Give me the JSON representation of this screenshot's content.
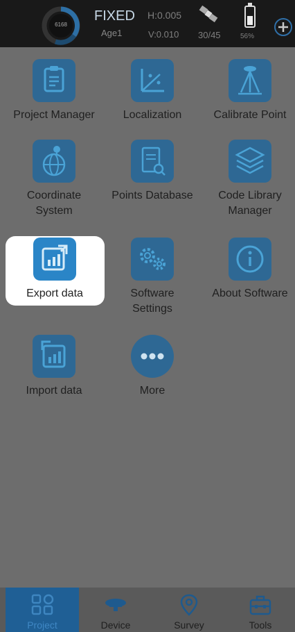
{
  "status": {
    "gauge_value": "6168",
    "fix_status": "FIXED",
    "age_label": "Age1",
    "h_precision": "H:0.005",
    "v_precision": "V:0.010",
    "satellites": "30/45",
    "battery_percent": "56%",
    "battery_level": 0.56
  },
  "menu": {
    "items": [
      {
        "label": "Project Manager",
        "icon": "clipboard-icon"
      },
      {
        "label": "Localization",
        "icon": "axes-icon"
      },
      {
        "label": "Calibrate Point",
        "icon": "tripod-icon"
      },
      {
        "label": "Coordinate System",
        "icon": "globe-pin-icon"
      },
      {
        "label": "Points Database",
        "icon": "document-search-icon"
      },
      {
        "label": "Code Library Manager",
        "icon": "layers-icon"
      },
      {
        "label": "Export data",
        "icon": "export-chart-icon"
      },
      {
        "label": "Software Settings",
        "icon": "gears-icon"
      },
      {
        "label": "About Software",
        "icon": "info-icon"
      },
      {
        "label": "Import data",
        "icon": "import-chart-icon"
      },
      {
        "label": "More",
        "icon": "more-dots-icon"
      }
    ]
  },
  "tabs": [
    {
      "label": "Project",
      "icon": "grid-icon",
      "active": true
    },
    {
      "label": "Device",
      "icon": "receiver-icon",
      "active": false
    },
    {
      "label": "Survey",
      "icon": "location-pin-icon",
      "active": false
    },
    {
      "label": "Tools",
      "icon": "toolbox-icon",
      "active": false
    }
  ],
  "colors": {
    "accent": "#1f6fb8",
    "fixed_text": "#c7d8e6",
    "overlay": "#6d6d6d"
  }
}
